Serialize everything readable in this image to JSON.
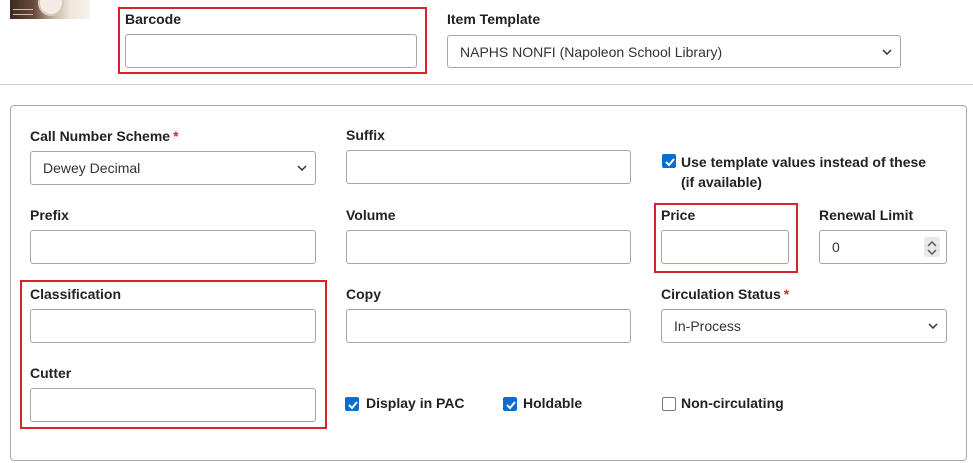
{
  "header": {
    "barcode": {
      "label": "Barcode",
      "value": ""
    },
    "item_template": {
      "label": "Item Template",
      "value": "NAPHS NONFI (Napoleon School Library)"
    }
  },
  "form": {
    "call_number_scheme": {
      "label": "Call Number Scheme",
      "required_mark": "*",
      "value": "Dewey Decimal"
    },
    "suffix": {
      "label": "Suffix",
      "value": ""
    },
    "use_template_values": {
      "label_line1": "Use template values instead of these",
      "label_line2": "(if available)",
      "checked": true
    },
    "prefix": {
      "label": "Prefix",
      "value": ""
    },
    "volume": {
      "label": "Volume",
      "value": ""
    },
    "price": {
      "label": "Price",
      "value": ""
    },
    "renewal_limit": {
      "label": "Renewal Limit",
      "value": "0"
    },
    "classification": {
      "label": "Classification",
      "value": ""
    },
    "copy": {
      "label": "Copy",
      "value": ""
    },
    "circulation_status": {
      "label": "Circulation Status",
      "required_mark": "*",
      "value": "In-Process"
    },
    "cutter": {
      "label": "Cutter",
      "value": ""
    },
    "display_in_pac": {
      "label": "Display in PAC",
      "checked": true
    },
    "holdable": {
      "label": "Holdable",
      "checked": true
    },
    "non_circulating": {
      "label": "Non-circulating",
      "checked": false
    }
  },
  "colors": {
    "highlight": "#d9232b",
    "checkbox": "#0a6ed1",
    "required": "#c9302c"
  }
}
